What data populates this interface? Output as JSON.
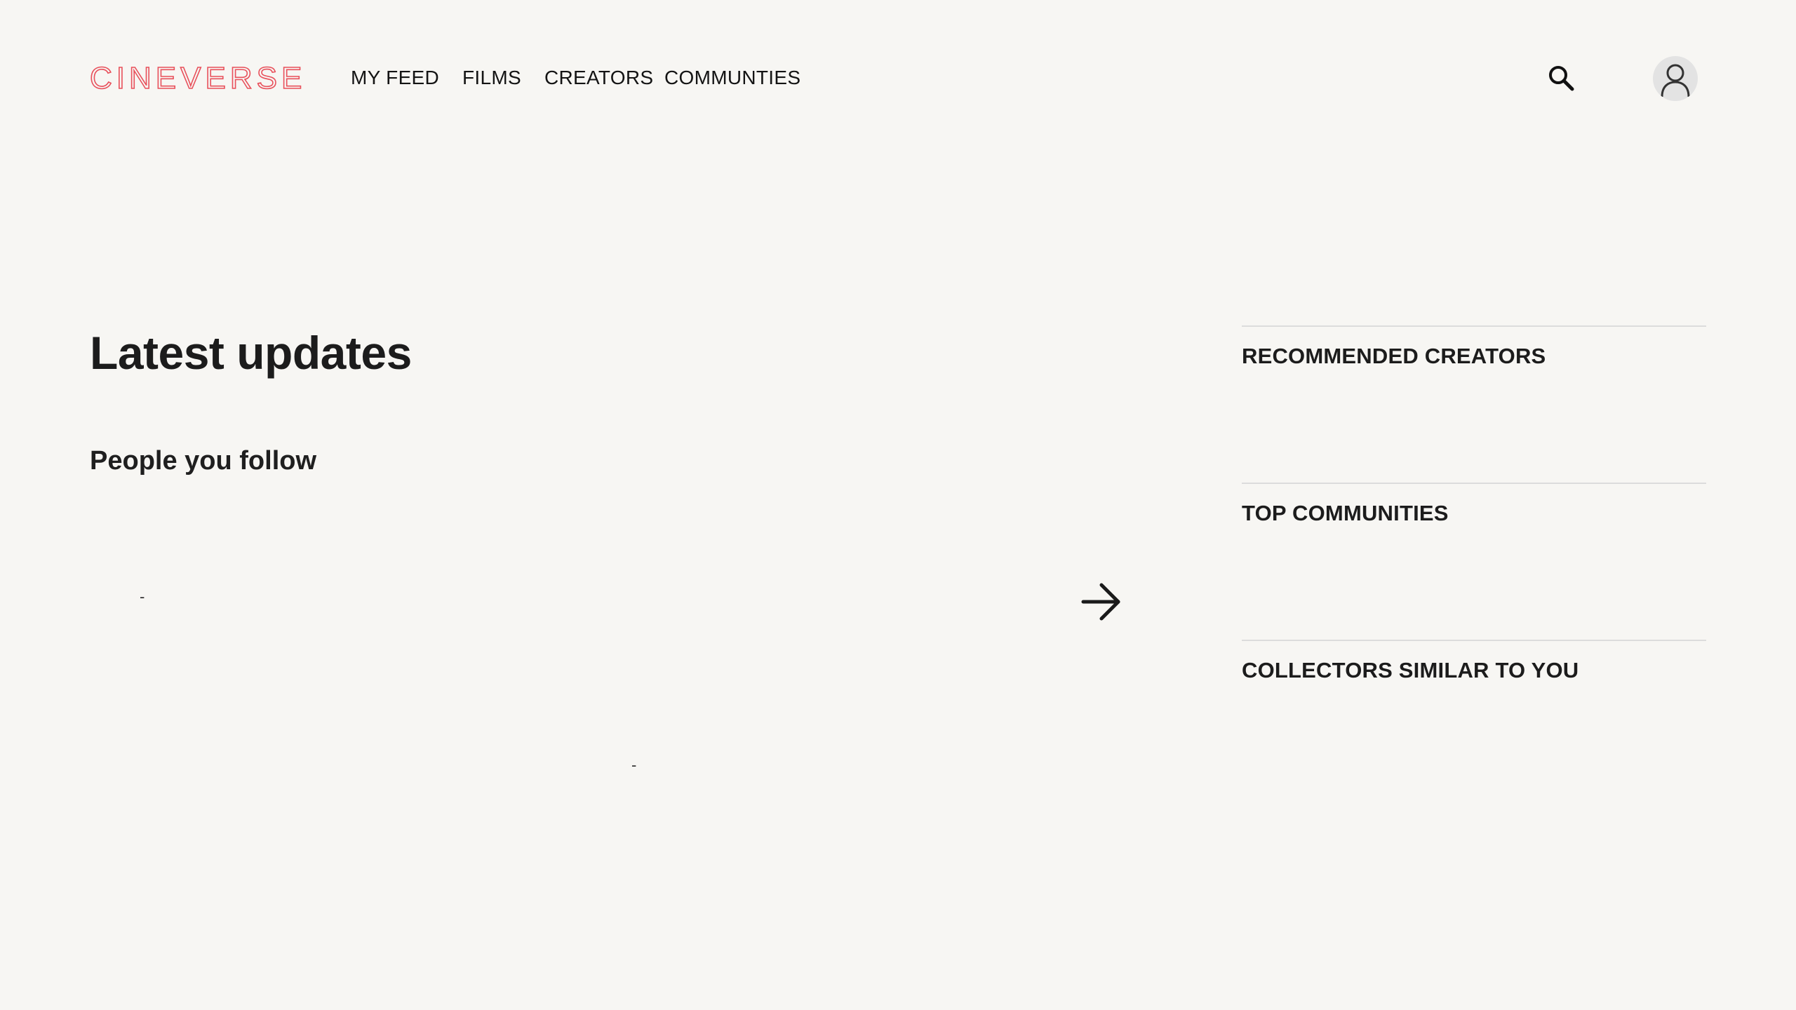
{
  "header": {
    "logo_text": "CINEVERSE",
    "brand_color": "#e8505b",
    "nav": [
      {
        "label": "MY FEED"
      },
      {
        "label": "FILMS"
      },
      {
        "label": "CREATORS"
      },
      {
        "label": "COMMUNTIES"
      }
    ],
    "search_icon": "search-icon",
    "avatar_icon": "user-avatar-icon"
  },
  "main": {
    "title": "Latest updates",
    "subtitle": "People you follow",
    "placeholder_a": "-",
    "placeholder_b": "-",
    "next_icon": "arrow-right-icon"
  },
  "sidebar": {
    "sections": [
      {
        "heading": "RECOMMENDED CREATORS"
      },
      {
        "heading": "TOP COMMUNITIES"
      },
      {
        "heading": "COLLECTORS SIMILAR TO YOU"
      }
    ]
  }
}
